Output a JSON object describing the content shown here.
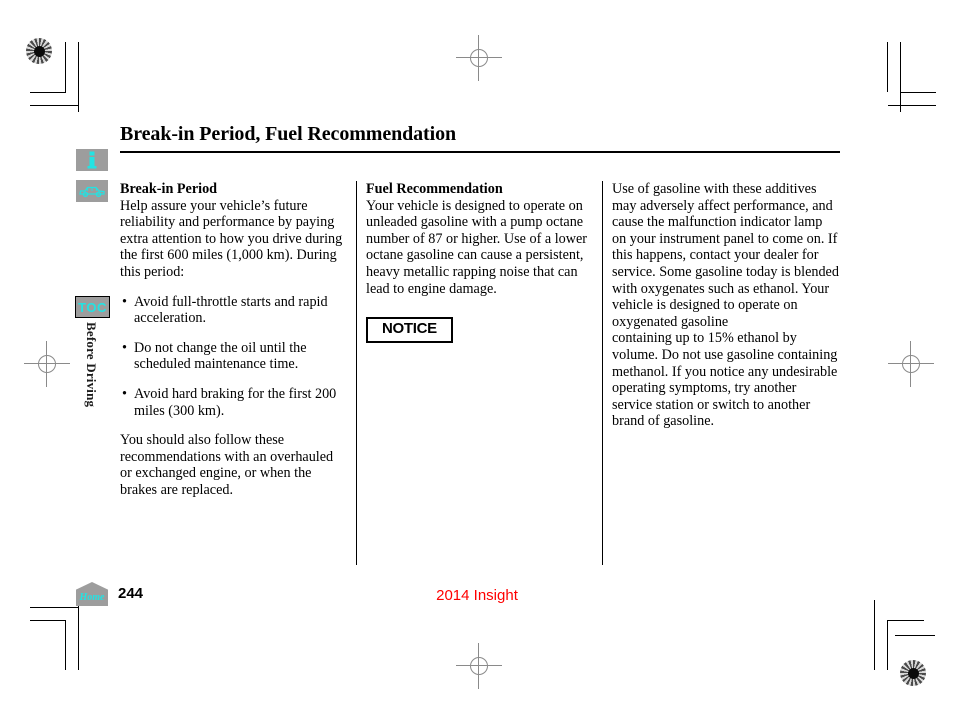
{
  "document": {
    "title": "Break-in Period, Fuel Recommendation",
    "page_number": "244",
    "model_label": "2014 Insight",
    "chapter_tab": "Before Driving",
    "toc_tab": "TOC",
    "home_label": "Home"
  },
  "icons": {
    "info": "information-icon",
    "vehicle": "vehicle-icon",
    "home": "home-icon"
  },
  "colors": {
    "accent_cyan": "#23e3e3",
    "tab_gray": "#9d9d9d",
    "model_red": "#ff0000",
    "text_black": "#000000"
  },
  "columns": {
    "left": {
      "heading": "Break-in Period",
      "intro": "Help assure your vehicle’s future reliability and performance by paying extra attention to how you drive during the first 600 miles (1,000 km). During this period:",
      "bullets": [
        "Avoid full-throttle starts and rapid acceleration.",
        "Do not change the oil until the scheduled maintenance time.",
        "Avoid hard braking for the first 200 miles (300 km)."
      ],
      "closing": "You should also follow these recommendations with an overhauled or exchanged engine, or when the brakes are replaced."
    },
    "middle": {
      "heading": "Fuel Recommendation",
      "body": "Your vehicle is designed to operate on unleaded gasoline with a pump octane number of 87 or higher. Use of a lower octane gasoline can cause a persistent, heavy metallic rapping noise that can lead to engine damage.",
      "notice_label": "NOTICE"
    },
    "right": {
      "body_part_1": "Use of gasoline with these additives may adversely affect performance, and cause the malfunction indicator lamp on your instrument panel to come on. If this happens, contact your dealer for service. Some gasoline today is blended with oxygenates such as ethanol. Your vehicle is designed to operate on oxygenated gasoline",
      "body_part_2": "containing up to 15% ethanol by volume. Do not use gasoline containing methanol. If you notice any undesirable operating symptoms, try another service station or switch to another brand of gasoline."
    }
  }
}
